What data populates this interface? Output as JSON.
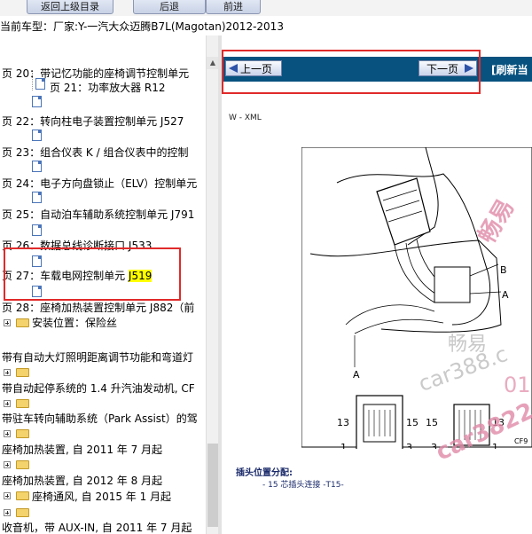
{
  "toolbar": {
    "buttons": [
      "返回上级目录",
      "后退",
      "前进"
    ]
  },
  "car_type": {
    "label": "当前车型：",
    "value": "厂家:Y-一汽大众迈腾B7L(Magotan)2012-2013"
  },
  "tree": {
    "items": [
      {
        "text": "页 20：带记忆功能的座椅调节控制单元"
      },
      {
        "text": "页 21：功率放大器 R12"
      },
      {
        "text": "页 22：转向柱电子装置控制单元 J527"
      },
      {
        "text": "页 23：组合仪表 K / 组合仪表中的控制"
      },
      {
        "text": "页 24：电子方向盘锁止（ELV）控制单元"
      },
      {
        "text": "页 25：自动泊车辅助系统控制单元 J791"
      },
      {
        "text": "页 26：数据总线诊断接口 J533"
      },
      {
        "text": "页 27：车载电网控制单元 ",
        "highlight": "J519"
      },
      {
        "text": "页 28：座椅加热装置控制单元 J882（前"
      },
      {
        "text": "安装位置：保险丝"
      },
      {
        "text": "带有自动大灯照明距离调节功能和弯道灯"
      },
      {
        "text": "带自动起停系统的 1.4 升汽油发动机, CF"
      },
      {
        "text": "带驻车转向辅助系统（Park Assist）的驾"
      },
      {
        "text": "座椅加热装置, 自 2011 年 7 月起"
      },
      {
        "text": "座椅加热装置, 自 2012 年 8 月起"
      },
      {
        "text": "座椅通风, 自 2015 年 1 月起"
      },
      {
        "text": "收音机，带 AUX-IN, 自 2011 年 7 月起"
      }
    ]
  },
  "nav": {
    "prev_label": "上一页",
    "next_label": "下一页",
    "refresh_label": "[刷新当"
  },
  "content": {
    "caption": "W - XML",
    "callouts": {
      "A_top": "A",
      "B": "B",
      "A_side": "A",
      "A_connector": "A",
      "left_13": "13",
      "left_15": "15",
      "left_1": "1",
      "left_3": "3",
      "right_15": "15",
      "right_13": "13",
      "right_3": "3",
      "right_1": "1"
    },
    "figure_code": "CF9",
    "pin_title": "插头位置分配:",
    "pin_item": "- 15 芯插头连接 -T15-"
  },
  "watermarks": [
    "畅易",
    "畅易",
    "car388.c",
    "01",
    "car3822"
  ],
  "colors": {
    "nav_bar": "#07527f",
    "highlight": "#ffff00",
    "annotation_box": "#e12a2a",
    "watermark": "#e08aa8"
  }
}
